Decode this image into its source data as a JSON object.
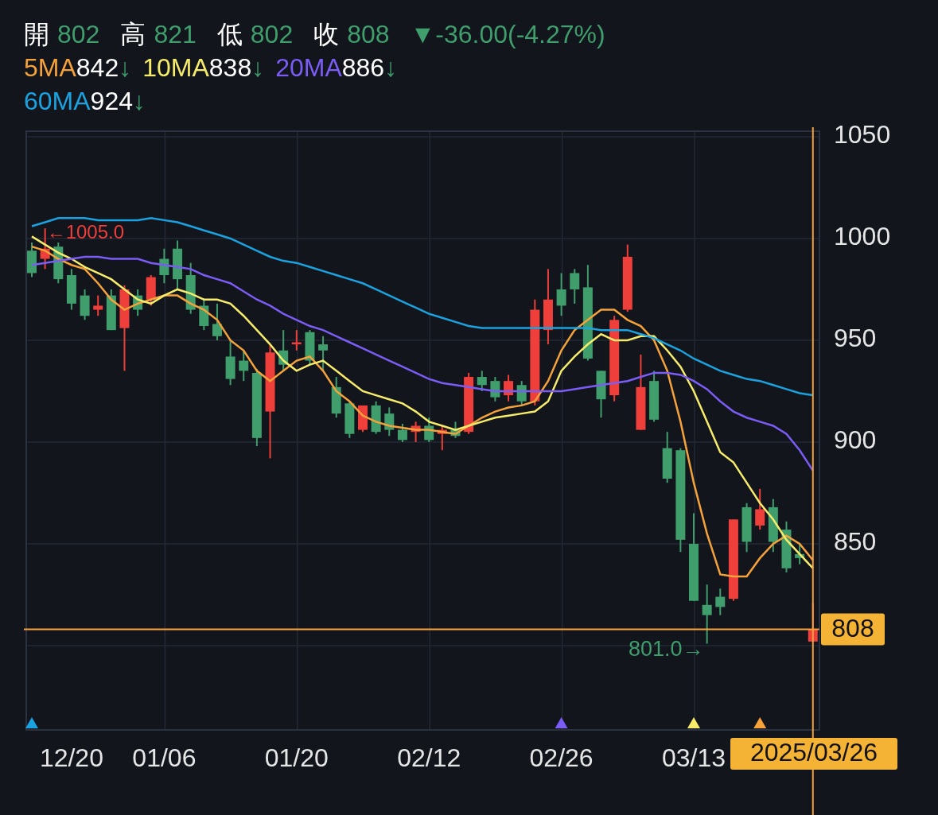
{
  "quote": {
    "items": [
      {
        "label": "開",
        "value": "802"
      },
      {
        "label": "高",
        "value": "821"
      },
      {
        "label": "低",
        "value": "802"
      },
      {
        "label": "收",
        "value": "808"
      }
    ],
    "change": "▼-36.00(-4.27%)"
  },
  "legend_rows": [
    [
      {
        "value": "842",
        "arrow": "↓"
      },
      {
        "value": "838",
        "arrow": "↓"
      },
      {
        "value": "886",
        "arrow": "↓"
      }
    ],
    [
      {
        "value": "924",
        "arrow": "↓"
      }
    ]
  ],
  "chart": {
    "candles": {
      "chart_data": {
        "type": "candlestick",
        "categories": [
          null,
          null,
          null,
          "12/20",
          null,
          null,
          null,
          null,
          null,
          null,
          "01/06",
          null,
          null,
          null,
          null,
          null,
          null,
          null,
          null,
          null,
          "01/20",
          null,
          null,
          null,
          null,
          null,
          null,
          null,
          null,
          null,
          "02/12",
          null,
          null,
          null,
          null,
          null,
          null,
          null,
          null,
          null,
          "02/26",
          null,
          null,
          null,
          null,
          null,
          null,
          null,
          null,
          null,
          "03/13",
          null,
          null,
          null,
          null,
          null,
          null,
          null,
          null,
          null
        ],
        "ylim": [
          758.6,
          1052.7
        ],
        "grid": true,
        "yticks": [
          850,
          900,
          950,
          1000,
          1050
        ],
        "ohlc": [
          [
            994,
            998,
            981,
            983
          ],
          [
            990,
            1005,
            985,
            995
          ],
          [
            996,
            998,
            978,
            980
          ],
          [
            982,
            985,
            965,
            968
          ],
          [
            972,
            975,
            960,
            962
          ],
          [
            965,
            972,
            962,
            967
          ],
          [
            972,
            975,
            955,
            955
          ],
          [
            956,
            977,
            935,
            975
          ],
          [
            972,
            975,
            962,
            965
          ],
          [
            970,
            982,
            967,
            981
          ],
          [
            990,
            995,
            978,
            982
          ],
          [
            995,
            999,
            975,
            980
          ],
          [
            982,
            988,
            963,
            965
          ],
          [
            967,
            970,
            955,
            957
          ],
          [
            958,
            968,
            950,
            952
          ],
          [
            942,
            950,
            928,
            931
          ],
          [
            940,
            945,
            930,
            935
          ],
          [
            934,
            936,
            898,
            902
          ],
          [
            915,
            948,
            892,
            944
          ],
          [
            945,
            955,
            935,
            938
          ],
          [
            948,
            955,
            945,
            949
          ],
          [
            954,
            955,
            938,
            940
          ],
          [
            948,
            952,
            935,
            945
          ],
          [
            927,
            932,
            912,
            914
          ],
          [
            919,
            920,
            902,
            904
          ],
          [
            906,
            918,
            905,
            918
          ],
          [
            918,
            920,
            904,
            905
          ],
          [
            914,
            917,
            903,
            906
          ],
          [
            906,
            909,
            900,
            901
          ],
          [
            905,
            910,
            900,
            908
          ],
          [
            908,
            912,
            900,
            901
          ],
          [
            904,
            908,
            896,
            906
          ],
          [
            906,
            910,
            902,
            903
          ],
          [
            905,
            934,
            904,
            932
          ],
          [
            932,
            935,
            925,
            928
          ],
          [
            930,
            932,
            920,
            922
          ],
          [
            923,
            933,
            920,
            930
          ],
          [
            928,
            930,
            918,
            920
          ],
          [
            920,
            970,
            918,
            965
          ],
          [
            955,
            985,
            948,
            970
          ],
          [
            975,
            983,
            962,
            967
          ],
          [
            983,
            985,
            968,
            975
          ],
          [
            976,
            987,
            940,
            941
          ],
          [
            935,
            935,
            912,
            921
          ],
          [
            923,
            962,
            920,
            960
          ],
          [
            965,
            997,
            964,
            991
          ],
          [
            906,
            943,
            906,
            927
          ],
          [
            930,
            935,
            910,
            911
          ],
          [
            897,
            905,
            880,
            882
          ],
          [
            896,
            897,
            846,
            852
          ],
          [
            850,
            865,
            822,
            822
          ],
          [
            820,
            830,
            801,
            815
          ],
          [
            824,
            828,
            815,
            819
          ],
          [
            823,
            862,
            822,
            862
          ],
          [
            868,
            870,
            846,
            851
          ],
          [
            859,
            877,
            857,
            867
          ],
          [
            868,
            872,
            846,
            851
          ],
          [
            857,
            861,
            836,
            838
          ],
          [
            845,
            850,
            840,
            843
          ],
          [
            802,
            821,
            802,
            808
          ]
        ],
        "ref_lines": [
          {
            "axis": "y",
            "value": 808,
            "label": "808"
          }
        ],
        "annotations": [
          "←1005.0",
          "801.0→"
        ]
      }
    },
    "moving_averages": {
      "chart_data": {
        "type": "line",
        "ylim": [
          758.6,
          1052.7
        ],
        "series": [
          {
            "name": "5MA",
            "color": "#f5a23a",
            "values": [
              996,
              994,
              990,
              987,
              985,
              978,
              970,
              965,
              968,
              970,
              972,
              972,
              968,
              965,
              960,
              950,
              945,
              935,
              930,
              935,
              940,
              942,
              935,
              925,
              920,
              913,
              910,
              908,
              907,
              906,
              906,
              905,
              904,
              908,
              912,
              915,
              917,
              918,
              920,
              930,
              945,
              955,
              960,
              965,
              965,
              960,
              957,
              950,
              935,
              910,
              880,
              855,
              835,
              834,
              834,
              843,
              850,
              854,
              850,
              842
            ]
          },
          {
            "name": "10MA",
            "color": "#f7ec6a",
            "values": [
              1001,
              997,
              993,
              990,
              986,
              983,
              980,
              975,
              970,
              968,
              972,
              975,
              973,
              970,
              970,
              968,
              962,
              955,
              948,
              940,
              935,
              938,
              940,
              935,
              930,
              925,
              923,
              921,
              919,
              915,
              910,
              908,
              906,
              908,
              910,
              912,
              913,
              914,
              915,
              920,
              935,
              942,
              948,
              953,
              950,
              950,
              952,
              952,
              945,
              937,
              925,
              910,
              895,
              890,
              880,
              870,
              862,
              852,
              845,
              838
            ]
          },
          {
            "name": "20MA",
            "color": "#7b5cf5",
            "values": [
              987,
              988,
              989,
              990,
              991,
              991,
              990,
              990,
              990,
              988,
              987,
              986,
              985,
              982,
              980,
              978,
              974,
              970,
              967,
              963,
              960,
              957,
              955,
              952,
              949,
              946,
              943,
              940,
              937,
              934,
              931,
              929,
              928,
              927,
              926,
              925,
              925,
              925,
              925,
              925,
              925,
              926,
              927,
              928,
              929,
              930,
              932,
              934,
              934,
              933,
              930,
              926,
              920,
              915,
              912,
              910,
              908,
              904,
              896,
              886
            ]
          },
          {
            "name": "60MA",
            "color": "#1aa3e0",
            "values": [
              1006,
              1008,
              1010,
              1010,
              1010,
              1009,
              1009,
              1009,
              1009,
              1010,
              1009,
              1008,
              1006,
              1004,
              1002,
              1000,
              997,
              994,
              991,
              989,
              988,
              986,
              984,
              982,
              980,
              978,
              975,
              972,
              969,
              966,
              963,
              961,
              959,
              957,
              956,
              956,
              956,
              956,
              956,
              956,
              956,
              956,
              956,
              955,
              955,
              955,
              953,
              951,
              948,
              945,
              941,
              938,
              935,
              933,
              931,
              930,
              928,
              926,
              924,
              923
            ]
          }
        ]
      }
    },
    "markers": [
      {
        "color": "#1aa3e0"
      },
      {
        "color": "#7b5cf5"
      },
      {
        "color": "#f7ec6a"
      },
      {
        "color": "#f5a23a"
      }
    ],
    "crosshair": {
      "date_label": "2025/03/26"
    }
  }
}
